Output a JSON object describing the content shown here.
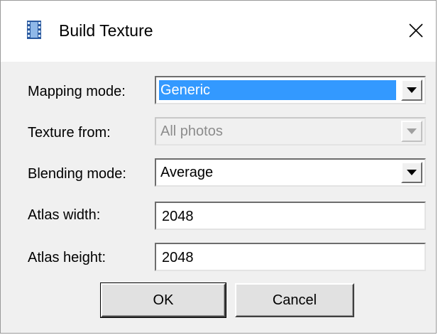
{
  "window": {
    "title": "Build Texture",
    "icon": "film-icon",
    "close_icon": "close-icon"
  },
  "form": {
    "mapping_mode": {
      "label": "Mapping mode:",
      "value": "Generic",
      "selected": true
    },
    "texture_from": {
      "label": "Texture from:",
      "value": "All photos",
      "disabled": true
    },
    "blending_mode": {
      "label": "Blending mode:",
      "value": "Average"
    },
    "atlas_width": {
      "label": "Atlas width:",
      "value": "2048"
    },
    "atlas_height": {
      "label": "Atlas height:",
      "value": "2048"
    }
  },
  "buttons": {
    "ok_label": "OK",
    "cancel_label": "Cancel"
  },
  "colors": {
    "selection": "#3399ff",
    "dialog_bg": "#f0f0f0"
  }
}
